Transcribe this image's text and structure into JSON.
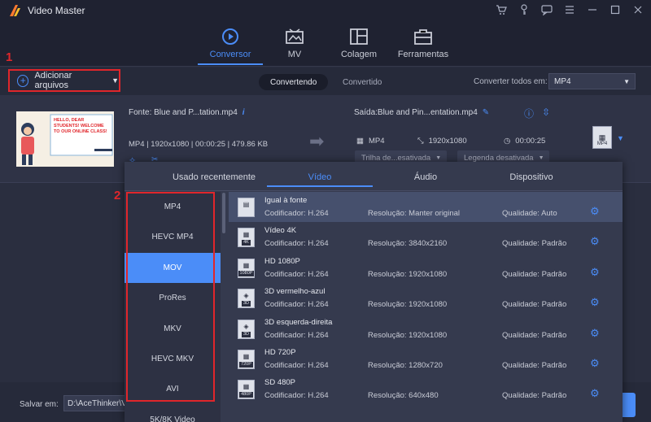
{
  "app": {
    "title": "Video Master"
  },
  "nav": {
    "tabs": [
      {
        "label": "Conversor",
        "icon": "convert-icon"
      },
      {
        "label": "MV",
        "icon": "mv-icon"
      },
      {
        "label": "Colagem",
        "icon": "collage-icon"
      },
      {
        "label": "Ferramentas",
        "icon": "toolbox-icon"
      }
    ],
    "active": "Conversor"
  },
  "annotations": {
    "marker1": "1",
    "marker2": "2"
  },
  "toolbar": {
    "add_label": "Adicionar arquivos",
    "seg_converting": "Convertendo",
    "seg_converted": "Convertido",
    "convert_all_label": "Converter todos em:",
    "convert_all_value": "MP4"
  },
  "file": {
    "thumb_text": "HELLO, DEAR STUDENTS! WELCOME TO OUR ONLINE CLASS!",
    "source": "Fonte: Blue and P...tation.mp4",
    "meta": "MP4 | 1920x1080 | 00:00:25 | 479.86 KB",
    "output": "Saída:Blue and Pin...entation.mp4",
    "out_format": "MP4",
    "out_resolution": "1920x1080",
    "out_duration": "00:00:25",
    "audio_track": "Trilha de...esativada",
    "subtitle": "Legenda desativada",
    "chip_label": "MP4"
  },
  "bottom": {
    "save_label": "Salvar em:",
    "save_path": "D:\\AceThinker\\Video Master"
  },
  "popup": {
    "tabs": [
      "Usado recentemente",
      "Vídeo",
      "Áudio",
      "Dispositivo"
    ],
    "active_tab": "Vídeo",
    "formats": [
      "MP4",
      "HEVC MP4",
      "MOV",
      "ProRes",
      "MKV",
      "HEVC MKV",
      "AVI",
      "5K/8K Video"
    ],
    "selected_format": "MOV",
    "presets": [
      {
        "name": "Igual à fonte",
        "codec": "Codificador: H.264",
        "resolution": "Resolução: Manter original",
        "quality": "Qualidade: Auto",
        "icon": "same-source-icon",
        "tag": ""
      },
      {
        "name": "Vídeo 4K",
        "codec": "Codificador: H.264",
        "resolution": "Resolução: 3840x2160",
        "quality": "Qualidade: Padrão",
        "icon": "film-icon",
        "tag": "4K"
      },
      {
        "name": "HD 1080P",
        "codec": "Codificador: H.264",
        "resolution": "Resolução: 1920x1080",
        "quality": "Qualidade: Padrão",
        "icon": "film-icon",
        "tag": "1080P"
      },
      {
        "name": "3D vermelho-azul",
        "codec": "Codificador: H.264",
        "resolution": "Resolução: 1920x1080",
        "quality": "Qualidade: Padrão",
        "icon": "cube-icon",
        "tag": "3D"
      },
      {
        "name": "3D esquerda-direita",
        "codec": "Codificador: H.264",
        "resolution": "Resolução: 1920x1080",
        "quality": "Qualidade: Padrão",
        "icon": "cube-icon",
        "tag": "3D"
      },
      {
        "name": "HD 720P",
        "codec": "Codificador: H.264",
        "resolution": "Resolução: 1280x720",
        "quality": "Qualidade: Padrão",
        "icon": "film-icon",
        "tag": "720P"
      },
      {
        "name": "SD 480P",
        "codec": "Codificador: H.264",
        "resolution": "Resolução: 640x480",
        "quality": "Qualidade: Padrão",
        "icon": "film-icon",
        "tag": "480P"
      }
    ]
  },
  "colors": {
    "accent": "#4b8df8",
    "highlight": "#e0262b",
    "background": "#2a2e3f"
  }
}
